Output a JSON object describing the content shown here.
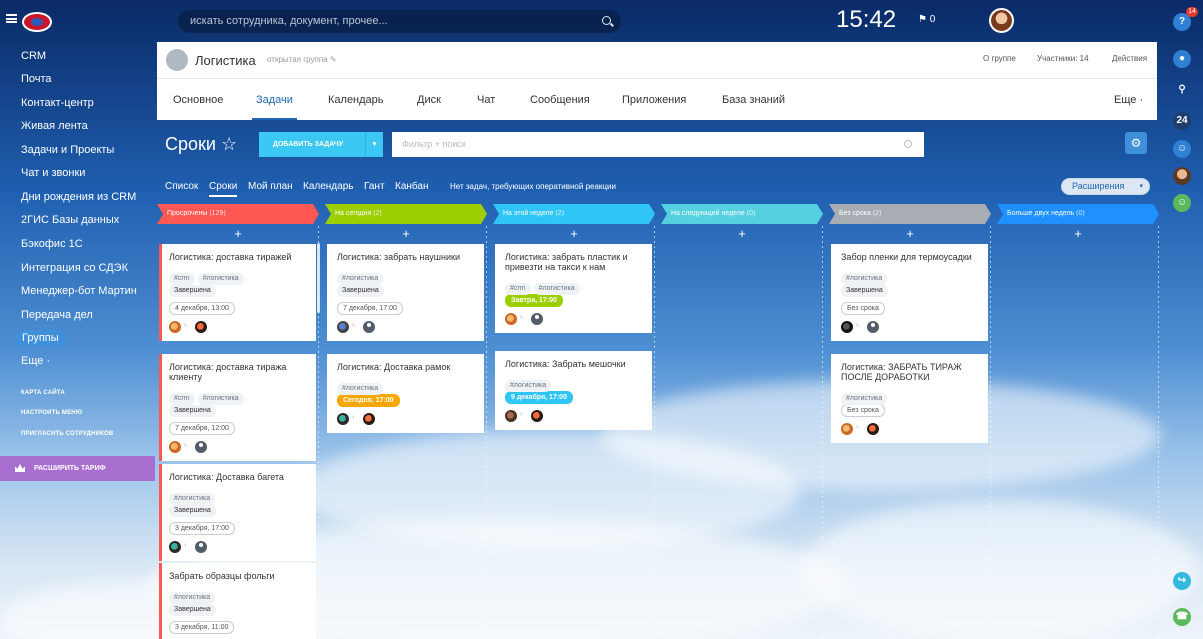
{
  "header": {
    "search_placeholder": "искать сотрудника, документ, прочее...",
    "clock": "15:42",
    "flag_count": "0",
    "help_badge": "14"
  },
  "sidebar": {
    "items": [
      "CRM",
      "Почта",
      "Контакт-центр",
      "Живая лента",
      "Задачи и Проекты",
      "Чат и звонки",
      "Дни рождения из CRM",
      "2ГИС Базы данных",
      "Бэкофис 1С",
      "Интеграция со СДЭК",
      "Менеджер-бот Мартин",
      "Передача дел",
      "Группы",
      "Еще ·"
    ],
    "small_links": [
      "КАРТА САЙТА",
      "НАСТРОИТЬ МЕНЮ",
      "ПРИГЛАСИТЬ СОТРУДНИКОВ"
    ],
    "upgrade_label": "РАСШИРИТЬ ТАРИФ"
  },
  "group": {
    "name": "Логистика",
    "type": "открытая группа",
    "links": [
      "О группе",
      "Участники: 14",
      "Действия"
    ],
    "tabs": [
      "Основное",
      "Задачи",
      "Календарь",
      "Диск",
      "Чат",
      "Сообщения",
      "Приложения",
      "База знаний",
      "Еще ·"
    ]
  },
  "toolbar": {
    "title": "Сроки",
    "add_task": "ДОБАВИТЬ ЗАДАЧУ",
    "filter_placeholder": "Фильтр + поиск",
    "views": [
      "Список",
      "Сроки",
      "Мой план",
      "Календарь",
      "Гант",
      "Канбан"
    ],
    "no_tasks": "Нет задач, требующих оперативной реакции",
    "extensions": "Расширения"
  },
  "colors": {
    "overdue": "#ff5752",
    "today": "#9dcf00",
    "week": "#2fc6f6",
    "nextweek": "#55d0e0",
    "nodeadline": "#a8adb4",
    "later": "#1e90ff"
  },
  "columns": [
    {
      "title": "Просрочены",
      "count": "(129)",
      "color": "#ff5752",
      "cards": [
        {
          "title": "Логистика: доставка тиражей",
          "tags": [
            "#crm",
            "#логистика"
          ],
          "status": "Завершена",
          "deadline": "4 декабря, 13:00",
          "style": "plain",
          "a1": "ph1",
          "a2": "ph2"
        },
        {
          "title": "Логистика: доставка тиража клиенту",
          "tags": [
            "#crm",
            "#логистика"
          ],
          "status": "Завершена",
          "deadline": "7 декабря, 12:00",
          "style": "plain",
          "a1": "ph1",
          "a2": "ghost"
        },
        {
          "title": "Логистика: Доставка багета",
          "tags": [
            "#логистика"
          ],
          "status": "Завершена",
          "deadline": "3 декабря, 17:00",
          "style": "plain",
          "a1": "ph4",
          "a2": "ghost"
        },
        {
          "title": "Забрать образцы фольги",
          "tags": [
            "#логистика"
          ],
          "status": "Завершена",
          "deadline": "3 декабря, 11:00",
          "style": "plain",
          "a1": "",
          "a2": ""
        }
      ]
    },
    {
      "title": "На сегодня",
      "count": "(2)",
      "color": "#9dcf00",
      "cards": [
        {
          "title": "Логистика: забрать наушники",
          "tags": [
            "#логистика"
          ],
          "status": "Завершена",
          "deadline": "7 декабря, 17:00",
          "style": "plain",
          "a1": "ph3",
          "a2": "ghost"
        },
        {
          "title": "Логистика: Доставка рамок",
          "tags": [
            "#логистика"
          ],
          "status": "",
          "deadline": "Сегодня, 17:00",
          "style": "orange",
          "a1": "ph4",
          "a2": "ph2"
        }
      ]
    },
    {
      "title": "На этой неделе",
      "count": "(2)",
      "color": "#2fc6f6",
      "cards": [
        {
          "title": "Логистика: забрать пластик и привезти на такси к нам",
          "tags": [
            "#crm",
            "#логистика"
          ],
          "status": "",
          "deadline": "Завтра, 17:00",
          "style": "green",
          "a1": "ph1",
          "a2": "ghost"
        },
        {
          "title": "Логистика: Забрать мешочки",
          "tags": [
            "#логистика"
          ],
          "status": "",
          "deadline": "9 декабря, 17:00",
          "style": "blue",
          "a1": "ph5",
          "a2": "ph2"
        }
      ]
    },
    {
      "title": "На следующей неделе",
      "count": "(0)",
      "color": "#55d0e0",
      "cards": []
    },
    {
      "title": "Без срока",
      "count": "(2)",
      "color": "#a8adb4",
      "cards": [
        {
          "title": "Забор пленки для термоусадки",
          "tags": [
            "#логистика"
          ],
          "status": "Завершена",
          "deadline": "Без срока",
          "style": "plain",
          "a1": "ph6",
          "a2": "ghost"
        },
        {
          "title": "Логистика: ЗАБРАТЬ ТИРАЖ ПОСЛЕ ДОРАБОТКИ",
          "tags": [
            "#логистика"
          ],
          "status": "",
          "deadline": "Без срока",
          "style": "plain",
          "a1": "ph1",
          "a2": "ph2"
        }
      ]
    },
    {
      "title": "Больше двух недель",
      "count": "(0)",
      "color": "#1e90ff",
      "cards": []
    }
  ]
}
